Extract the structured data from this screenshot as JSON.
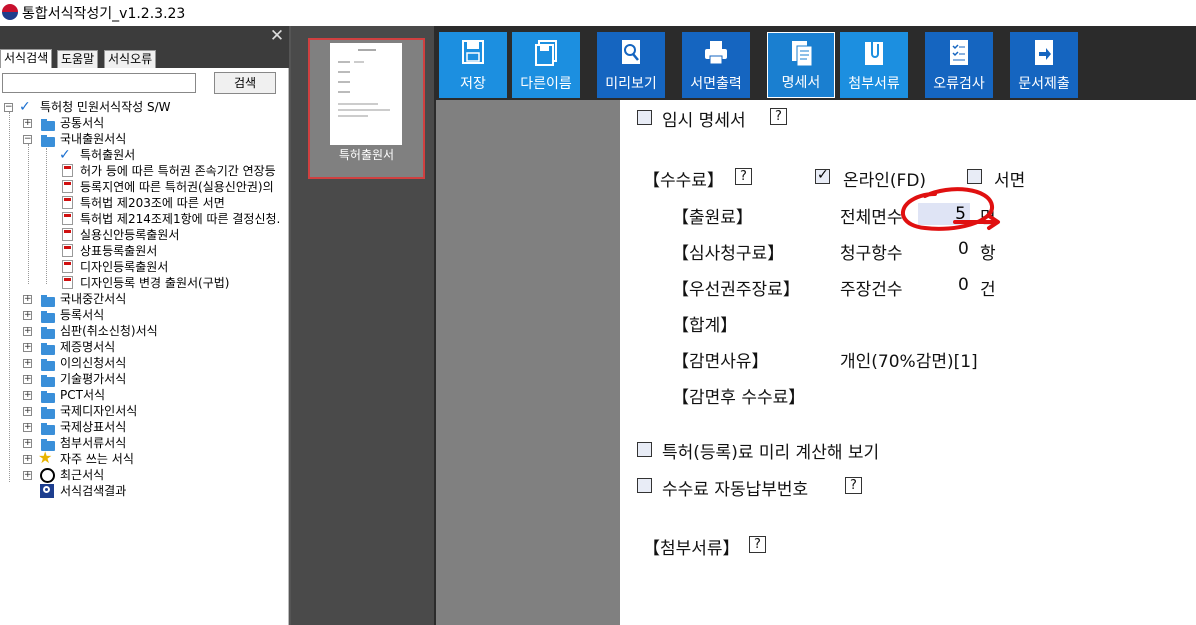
{
  "app": {
    "title": "통합서식작성기_v1.2.3.23"
  },
  "left_panel": {
    "tabs": [
      "서식검색",
      "도움말",
      "서식오류"
    ],
    "search_button": "검색",
    "tree": {
      "root": "특허청 민원서식작성 S/W",
      "items": [
        "공통서식",
        "국내출원서식",
        "특허출원서",
        "허가 등에 따른 특허권 존속기간 연장등",
        "등록지연에 따른 특허권(실용신안권)의",
        "특허법 제203조에 따른 서면",
        "특허법 제214조제1항에 따른 결정신청.",
        "실용신안등록출원서",
        "상표등록출원서",
        "디자인등록출원서",
        "디자인등록 변경 출원서(구법)",
        "국내중간서식",
        "등록서식",
        "심판(취소신청)서식",
        "제증명서식",
        "이의신청서식",
        "기술평가서식",
        "PCT서식",
        "국제디자인서식",
        "국제상표서식",
        "첨부서류서식",
        "자주 쓰는 서식",
        "최근서식",
        "서식검색결과"
      ]
    }
  },
  "thumbnail": {
    "label": "특허출원서"
  },
  "toolbar": {
    "buttons": [
      "저장",
      "다른이름",
      "미리보기",
      "서면출력",
      "명세서",
      "첨부서류",
      "오류검사",
      "문서제출"
    ]
  },
  "form": {
    "temp_spec": "임시 명세서",
    "help": "?",
    "fee_header": "【수수료】",
    "online_label": "온라인(FD)",
    "paper_label": "서면",
    "application_fee": "【출원료】",
    "total_pages_label": "전체면수",
    "total_pages_value": "5",
    "total_pages_unit": "면",
    "exam_fee": "【심사청구료】",
    "claims_label": "청구항수",
    "claims_value": "0",
    "claims_unit": "항",
    "priority_fee": "【우선권주장료】",
    "priority_label": "주장건수",
    "priority_value": "0",
    "priority_unit": "건",
    "total": "【합계】",
    "reduction_reason": "【감면사유】",
    "reduction_value": "개인(70%감면)[1]",
    "after_reduction": "【감면후 수수료】",
    "precalc": "특허(등록)료 미리 계산해 보기",
    "auto_payment": "수수료 자동납부번호",
    "attachments": "【첨부서류】"
  }
}
